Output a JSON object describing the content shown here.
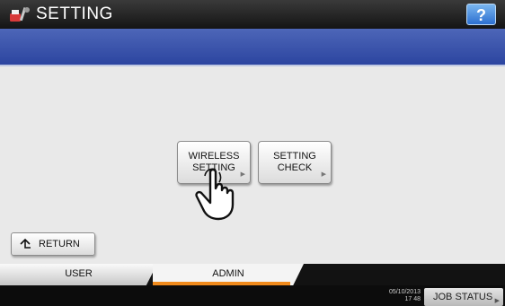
{
  "header": {
    "title": "SETTING",
    "help_label": "?"
  },
  "main": {
    "buttons": [
      {
        "label": "WIRELESS\nSETTING"
      },
      {
        "label": "SETTING\nCHECK"
      }
    ],
    "return_label": "RETURN"
  },
  "tabs": [
    {
      "label": "USER",
      "selected": false
    },
    {
      "label": "ADMIN",
      "selected": true
    }
  ],
  "status": {
    "date": "05/10/2013",
    "time": "17 48",
    "job_status_label": "JOB STATUS"
  },
  "icons": {
    "title": "printer-tools-icon",
    "pointer": "hand-pointer-icon",
    "return": "return-arrow-icon",
    "submenu": "submenu-arrow-icon"
  },
  "colors": {
    "header": "#1f1f1f",
    "bluebar": "#3a55aa",
    "help": "#3b82dd",
    "tab_accent": "#f08a1c"
  }
}
